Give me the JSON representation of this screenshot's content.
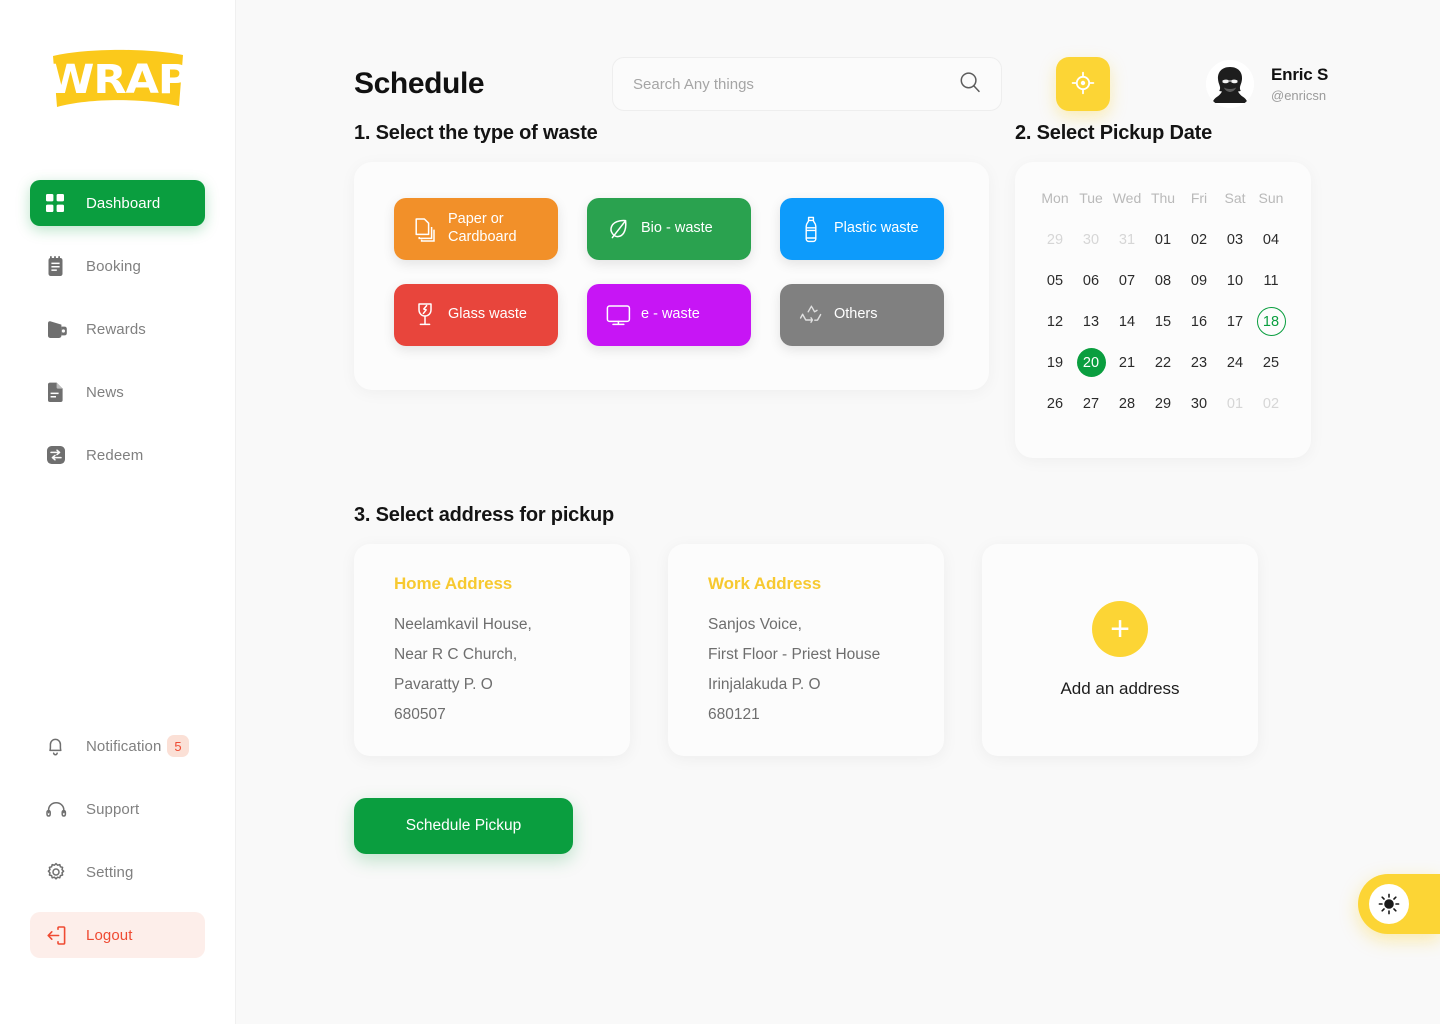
{
  "brand": {
    "logo_text": "WRAP",
    "logo_color": "#fbc91b"
  },
  "sidebar": {
    "top_items": [
      {
        "label": "Dashboard",
        "icon": "grid-icon",
        "active": true
      },
      {
        "label": "Booking",
        "icon": "notebook-icon",
        "active": false
      },
      {
        "label": "Rewards",
        "icon": "wallet-icon",
        "active": false
      },
      {
        "label": "News",
        "icon": "news-document-icon",
        "active": false
      },
      {
        "label": "Redeem",
        "icon": "exchange-icon",
        "active": false
      }
    ],
    "bottom_items": [
      {
        "label": "Notification",
        "icon": "bell-icon",
        "badge": "5"
      },
      {
        "label": "Support",
        "icon": "headphones-icon",
        "badge": ""
      },
      {
        "label": "Setting",
        "icon": "gear-icon",
        "badge": ""
      },
      {
        "label": "Logout",
        "icon": "logout-icon",
        "badge": ""
      }
    ]
  },
  "header": {
    "title": "Schedule",
    "search_placeholder": "Search Any things",
    "search_value": "",
    "search_icon": "search-icon",
    "location_icon": "crosshair-location-icon",
    "user": {
      "name": "Enric S",
      "handle": "@enricsn",
      "avatar": "user-avatar"
    }
  },
  "steps": {
    "waste_title": "1. Select the type of waste",
    "date_title": "2. Select Pickup Date",
    "address_title": "3. Select address for pickup"
  },
  "waste_types": [
    {
      "label": "Paper or Cardboard",
      "icon": "papers-icon",
      "color": "#f29029"
    },
    {
      "label": "Bio - waste",
      "icon": "leaf-icon",
      "color": "#2aa24f"
    },
    {
      "label": "Plastic waste",
      "icon": "bottle-icon",
      "color": "#0d9bfb"
    },
    {
      "label": "Glass waste",
      "icon": "broken-glass-icon",
      "color": "#e8453c"
    },
    {
      "label": "e - waste",
      "icon": "monitor-icon",
      "color": "#c715f5"
    },
    {
      "label": "Others",
      "icon": "recycle-icon",
      "color": "#808080"
    }
  ],
  "calendar": {
    "day_names": [
      "Mon",
      "Tue",
      "Wed",
      "Thu",
      "Fri",
      "Sat",
      "Sun"
    ],
    "selected_day": "20",
    "today": "18",
    "selected_color": "#0a9e3f",
    "weeks": [
      [
        {
          "d": "29",
          "muted": true
        },
        {
          "d": "30",
          "muted": true
        },
        {
          "d": "31",
          "muted": true
        },
        {
          "d": "01"
        },
        {
          "d": "02"
        },
        {
          "d": "03"
        },
        {
          "d": "04"
        }
      ],
      [
        {
          "d": "05"
        },
        {
          "d": "06"
        },
        {
          "d": "07"
        },
        {
          "d": "08"
        },
        {
          "d": "09"
        },
        {
          "d": "10"
        },
        {
          "d": "11"
        }
      ],
      [
        {
          "d": "12"
        },
        {
          "d": "13"
        },
        {
          "d": "14"
        },
        {
          "d": "15"
        },
        {
          "d": "16"
        },
        {
          "d": "17"
        },
        {
          "d": "18",
          "today": true
        }
      ],
      [
        {
          "d": "19"
        },
        {
          "d": "20",
          "selected": true
        },
        {
          "d": "21"
        },
        {
          "d": "22"
        },
        {
          "d": "23"
        },
        {
          "d": "24"
        },
        {
          "d": "25"
        }
      ],
      [
        {
          "d": "26"
        },
        {
          "d": "27"
        },
        {
          "d": "28"
        },
        {
          "d": "29"
        },
        {
          "d": "30"
        },
        {
          "d": "01",
          "muted": true
        },
        {
          "d": "02",
          "muted": true
        }
      ]
    ]
  },
  "addresses": [
    {
      "title": "Home Address",
      "lines": [
        "Neelamkavil House,",
        "Near R C Church,",
        "Pavaratty P. O",
        "680507"
      ]
    },
    {
      "title": "Work Address",
      "lines": [
        "Sanjos Voice,",
        "First Floor - Priest House",
        "Irinjalakuda P. O",
        "680121"
      ]
    }
  ],
  "add_address": {
    "label": "Add an address",
    "icon": "plus-icon"
  },
  "actions": {
    "schedule_label": "Schedule Pickup"
  },
  "theme_toggle": {
    "icon": "sun-icon"
  }
}
